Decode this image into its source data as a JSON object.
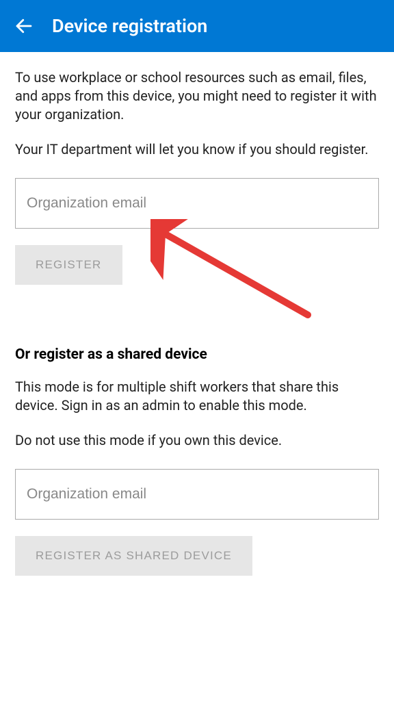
{
  "header": {
    "title": "Device registration"
  },
  "main": {
    "description1": "To use workplace or school resources such as email, files, and apps from this device, you might need to register it with your organization.",
    "description2": "Your IT department will let you know if you should register.",
    "email_placeholder": "Organization email",
    "register_button": "REGISTER"
  },
  "shared": {
    "heading": "Or register as a shared device",
    "description1": "This mode is for multiple shift workers that share this device. Sign in as an admin to enable this mode.",
    "description2": "Do not use this mode if you own this device.",
    "email_placeholder": "Organization email",
    "register_button": "REGISTER AS SHARED DEVICE"
  },
  "colors": {
    "header_bg": "#0078d4",
    "annotation": "#e53935"
  }
}
